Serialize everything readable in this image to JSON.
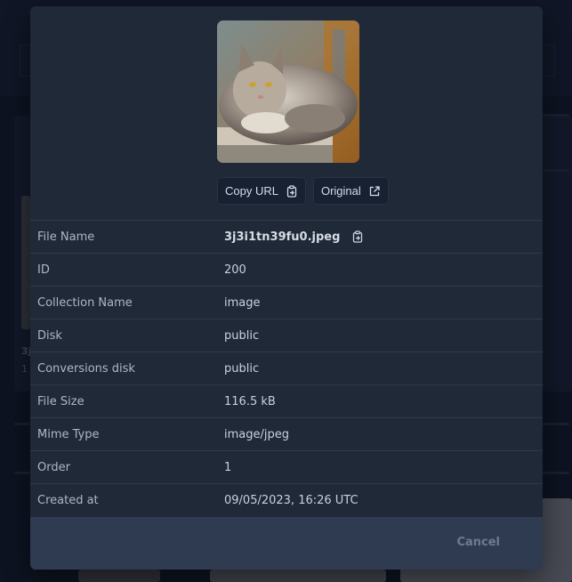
{
  "modal": {
    "image_alt_icon": "cat-photo",
    "buttons": {
      "copy_url": "Copy URL",
      "original": "Original"
    },
    "details": [
      {
        "label": "File Name",
        "value": "3j3i1tn39fu0.jpeg"
      },
      {
        "label": "ID",
        "value": "200"
      },
      {
        "label": "Collection Name",
        "value": "image"
      },
      {
        "label": "Disk",
        "value": "public"
      },
      {
        "label": "Conversions disk",
        "value": "public"
      },
      {
        "label": "File Size",
        "value": "116.5 kB"
      },
      {
        "label": "Mime Type",
        "value": "image/jpeg"
      },
      {
        "label": "Order",
        "value": "1"
      },
      {
        "label": "Created at",
        "value": "09/05/2023, 16:26 UTC"
      }
    ],
    "footer": {
      "cancel": "Cancel"
    }
  },
  "background": {
    "partial_labels": [
      "3j",
      "1"
    ]
  },
  "colors": {
    "modal_bg": "#1f2937",
    "footer_bg": "#2f3b51",
    "cancel_text": "#6f7b8d"
  }
}
